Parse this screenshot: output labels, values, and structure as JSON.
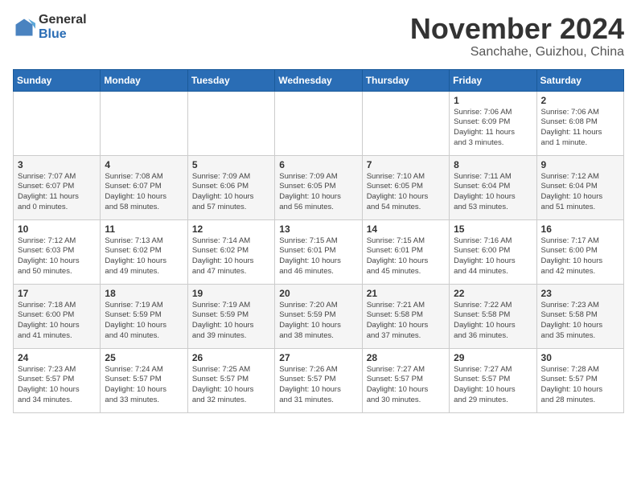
{
  "logo": {
    "general": "General",
    "blue": "Blue"
  },
  "header": {
    "month": "November 2024",
    "location": "Sanchahe, Guizhou, China"
  },
  "weekdays": [
    "Sunday",
    "Monday",
    "Tuesday",
    "Wednesday",
    "Thursday",
    "Friday",
    "Saturday"
  ],
  "weeks": [
    [
      {
        "day": "",
        "info": ""
      },
      {
        "day": "",
        "info": ""
      },
      {
        "day": "",
        "info": ""
      },
      {
        "day": "",
        "info": ""
      },
      {
        "day": "",
        "info": ""
      },
      {
        "day": "1",
        "info": "Sunrise: 7:06 AM\nSunset: 6:09 PM\nDaylight: 11 hours\nand 3 minutes."
      },
      {
        "day": "2",
        "info": "Sunrise: 7:06 AM\nSunset: 6:08 PM\nDaylight: 11 hours\nand 1 minute."
      }
    ],
    [
      {
        "day": "3",
        "info": "Sunrise: 7:07 AM\nSunset: 6:07 PM\nDaylight: 11 hours\nand 0 minutes."
      },
      {
        "day": "4",
        "info": "Sunrise: 7:08 AM\nSunset: 6:07 PM\nDaylight: 10 hours\nand 58 minutes."
      },
      {
        "day": "5",
        "info": "Sunrise: 7:09 AM\nSunset: 6:06 PM\nDaylight: 10 hours\nand 57 minutes."
      },
      {
        "day": "6",
        "info": "Sunrise: 7:09 AM\nSunset: 6:05 PM\nDaylight: 10 hours\nand 56 minutes."
      },
      {
        "day": "7",
        "info": "Sunrise: 7:10 AM\nSunset: 6:05 PM\nDaylight: 10 hours\nand 54 minutes."
      },
      {
        "day": "8",
        "info": "Sunrise: 7:11 AM\nSunset: 6:04 PM\nDaylight: 10 hours\nand 53 minutes."
      },
      {
        "day": "9",
        "info": "Sunrise: 7:12 AM\nSunset: 6:04 PM\nDaylight: 10 hours\nand 51 minutes."
      }
    ],
    [
      {
        "day": "10",
        "info": "Sunrise: 7:12 AM\nSunset: 6:03 PM\nDaylight: 10 hours\nand 50 minutes."
      },
      {
        "day": "11",
        "info": "Sunrise: 7:13 AM\nSunset: 6:02 PM\nDaylight: 10 hours\nand 49 minutes."
      },
      {
        "day": "12",
        "info": "Sunrise: 7:14 AM\nSunset: 6:02 PM\nDaylight: 10 hours\nand 47 minutes."
      },
      {
        "day": "13",
        "info": "Sunrise: 7:15 AM\nSunset: 6:01 PM\nDaylight: 10 hours\nand 46 minutes."
      },
      {
        "day": "14",
        "info": "Sunrise: 7:15 AM\nSunset: 6:01 PM\nDaylight: 10 hours\nand 45 minutes."
      },
      {
        "day": "15",
        "info": "Sunrise: 7:16 AM\nSunset: 6:00 PM\nDaylight: 10 hours\nand 44 minutes."
      },
      {
        "day": "16",
        "info": "Sunrise: 7:17 AM\nSunset: 6:00 PM\nDaylight: 10 hours\nand 42 minutes."
      }
    ],
    [
      {
        "day": "17",
        "info": "Sunrise: 7:18 AM\nSunset: 6:00 PM\nDaylight: 10 hours\nand 41 minutes."
      },
      {
        "day": "18",
        "info": "Sunrise: 7:19 AM\nSunset: 5:59 PM\nDaylight: 10 hours\nand 40 minutes."
      },
      {
        "day": "19",
        "info": "Sunrise: 7:19 AM\nSunset: 5:59 PM\nDaylight: 10 hours\nand 39 minutes."
      },
      {
        "day": "20",
        "info": "Sunrise: 7:20 AM\nSunset: 5:59 PM\nDaylight: 10 hours\nand 38 minutes."
      },
      {
        "day": "21",
        "info": "Sunrise: 7:21 AM\nSunset: 5:58 PM\nDaylight: 10 hours\nand 37 minutes."
      },
      {
        "day": "22",
        "info": "Sunrise: 7:22 AM\nSunset: 5:58 PM\nDaylight: 10 hours\nand 36 minutes."
      },
      {
        "day": "23",
        "info": "Sunrise: 7:23 AM\nSunset: 5:58 PM\nDaylight: 10 hours\nand 35 minutes."
      }
    ],
    [
      {
        "day": "24",
        "info": "Sunrise: 7:23 AM\nSunset: 5:57 PM\nDaylight: 10 hours\nand 34 minutes."
      },
      {
        "day": "25",
        "info": "Sunrise: 7:24 AM\nSunset: 5:57 PM\nDaylight: 10 hours\nand 33 minutes."
      },
      {
        "day": "26",
        "info": "Sunrise: 7:25 AM\nSunset: 5:57 PM\nDaylight: 10 hours\nand 32 minutes."
      },
      {
        "day": "27",
        "info": "Sunrise: 7:26 AM\nSunset: 5:57 PM\nDaylight: 10 hours\nand 31 minutes."
      },
      {
        "day": "28",
        "info": "Sunrise: 7:27 AM\nSunset: 5:57 PM\nDaylight: 10 hours\nand 30 minutes."
      },
      {
        "day": "29",
        "info": "Sunrise: 7:27 AM\nSunset: 5:57 PM\nDaylight: 10 hours\nand 29 minutes."
      },
      {
        "day": "30",
        "info": "Sunrise: 7:28 AM\nSunset: 5:57 PM\nDaylight: 10 hours\nand 28 minutes."
      }
    ]
  ]
}
